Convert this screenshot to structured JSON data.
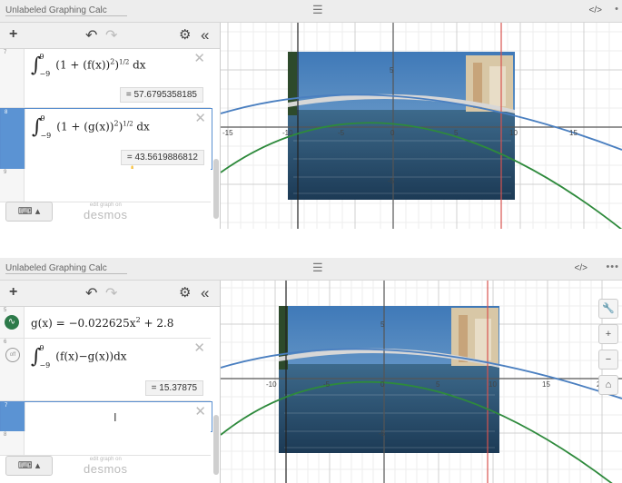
{
  "panel1": {
    "title": "Unlabeled Graphing Calc",
    "menu_icon": "hamburger-icon",
    "share_label": "</>",
    "more_label": "•",
    "toolbar": {
      "add_label": "+",
      "undo_label": "↶",
      "redo_label": "↷",
      "settings_label": "⚙",
      "collapse_label": "«"
    },
    "expressions": [
      {
        "num": "7",
        "upper": "9",
        "lower": "−9",
        "lead": "(1 + (f(x))",
        "pow": "2",
        "close": ")",
        "frac": "1/2",
        "tail": "dx",
        "result": "= 57.6795358185"
      },
      {
        "num": "8",
        "upper": "9",
        "lower": "−9",
        "lead": "(1 + (g(x))",
        "pow": "2",
        "close": ")",
        "frac": "1/2",
        "tail": "dx",
        "result": "= 43.5619886812"
      }
    ],
    "empty_num": "9",
    "keyboard_label": "⌨ ▴",
    "brand_small": "edit graph on",
    "brand_large": "desmos",
    "x_ticks": [
      "-15",
      "-10",
      "-5",
      "0",
      "5",
      "10",
      "15"
    ],
    "y_ticks": [
      "5",
      "-5"
    ]
  },
  "panel2": {
    "title": "Unlabeled Graphing Calc",
    "share_label": "</>",
    "more_label": "•••",
    "toolbar": {
      "add_label": "+",
      "undo_label": "↶",
      "redo_label": "↷",
      "settings_label": "⚙",
      "collapse_label": "«"
    },
    "expr_g": {
      "num": "5",
      "text": "g(x) = −0.022625x",
      "pow": "2",
      "tail": " + 2.8"
    },
    "expr_int": {
      "num": "6",
      "upper": "9",
      "lower": "−9",
      "body": "(f(x)−g(x))dx",
      "result": "= 15.37875"
    },
    "empty_num": "7",
    "empty_num2": "8",
    "cursor": "I",
    "keyboard_label": "⌨ ▴",
    "brand_small": "edit graph on",
    "brand_large": "desmos",
    "side_buttons": [
      "🔧",
      "+",
      "−",
      "⌂"
    ],
    "x_ticks": [
      "-10",
      "-5",
      "0",
      "5",
      "10",
      "15",
      "20"
    ],
    "y_ticks": [
      "5",
      "-5"
    ]
  },
  "colors": {
    "blue_curve": "#4a7fc0",
    "green_curve": "#2e8a3c",
    "red_line": "#d9534f",
    "accent": "#5b93d3"
  }
}
